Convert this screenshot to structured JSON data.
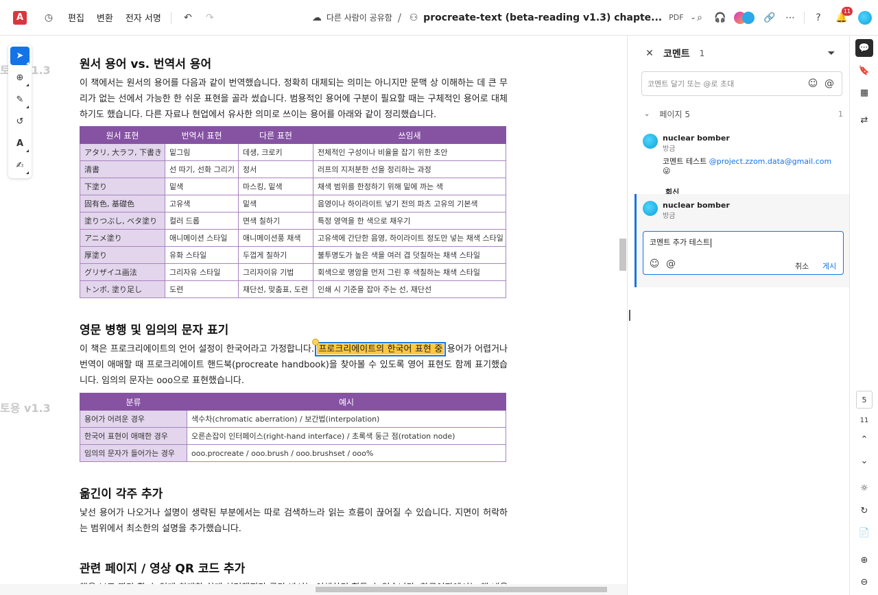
{
  "topbar": {
    "logo": "A",
    "menu": [
      "편집",
      "변환",
      "전자 서명"
    ],
    "share": "다른 사람이 공유함",
    "title": "procreate-text (beta-reading v1.3) chapte...",
    "filetype": "PDF",
    "notification_count": "11"
  },
  "ghost_labels": [
    "토용 v1.3",
    "토용 v1.3"
  ],
  "document": {
    "section1": {
      "heading": "원서 용어 vs. 번역서 용어",
      "body": "이 책에서는 원서의 용어를 다음과 같이 번역했습니다. 정확히 대체되는 의미는 아니지만 문맥 상 이해하는 데 큰 무리가 없는 선에서 가능한 한 쉬운 표현을 골라 썼습니다. 범용적인 용어에 구분이 필요할 때는 구체적인 용어로 대체하기도 했습니다. 다른 자료나 현업에서 유사한 의미로 쓰이는 용어를 아래와 같이 정리했습니다.",
      "table": {
        "headers": [
          "원서 표현",
          "번역서 표현",
          "다른 표현",
          "쓰임새"
        ],
        "rows": [
          [
            "アタリ, 大ラフ, 下書き",
            "밑그림",
            "데생, 크로키",
            "전체적인 구성이나 비율을 잡기 위한 초안"
          ],
          [
            "清書",
            "선 따기, 선화 그리기",
            "정서",
            "러프의 지저분한 선을 정리하는 과정"
          ],
          [
            "下塗り",
            "밑색",
            "마스킹, 밑색",
            "채색 범위를 한정하기 위해 밑에 까는 색"
          ],
          [
            "固有色, 基礎色",
            "고유색",
            "밑색",
            "음영이나 하이라이트 넣기 전의 파츠 고유의 기본색"
          ],
          [
            "塗りつぶし, ベタ塗り",
            "컬러 드롭",
            "면색 칠하기",
            "특정 영역을 한 색으로 채우기"
          ],
          [
            "アニメ塗り",
            "애니메이션 스타일",
            "애니메이션풍 채색",
            "고유색에 간단한 음영, 하이라이트 정도만 넣는 채색 스타일"
          ],
          [
            "厚塗り",
            "유화 스타일",
            "두껍게 칠하기",
            "불투명도가 높은 색을 여러 겹 덧칠하는 채색 스타일"
          ],
          [
            "グリザイユ画法",
            "그리자유 스타일",
            "그리자이유 기법",
            "회색으로 명암을 먼저 그린 후 색칠하는 채색 스타일"
          ],
          [
            "トンボ, 塗り足し",
            "도련",
            "재단선, 맞춤표, 도련",
            "인쇄 시 기준을 잡아 주는 선, 재단선"
          ]
        ]
      }
    },
    "section2": {
      "heading": "영문 병행 및 임의의 문자 표기",
      "body_before": "이 책은 프로크리에이트의 언어 설정이 한국어라고 가정합니다.",
      "highlight": "프로크리에이트의 한국어 표현 중",
      "body_after": "용어가 어렵거나 번역이 애매할 때 프로크리에이트 핸드북(procreate handbook)을 찾아볼 수 있도록 영어 표현도 함께 표기했습니다. 임의의 문자는 ooo으로 표현했습니다.",
      "table": {
        "headers": [
          "분류",
          "예시"
        ],
        "rows": [
          [
            "용어가 어려운 경우",
            "색수차(chromatic aberration) / 보간법(interpolation)"
          ],
          [
            "한국어 표현이 애매한 경우",
            "오른손잡이 인터페이스(right-hand interface) / 초록색 둥근 점(rotation node)"
          ],
          [
            "임의의 문자가 들어가는 경우",
            "ooo.procreate / ooo.brush / ooo.brushset / ooo%"
          ]
        ]
      }
    },
    "section3": {
      "heading": "옮긴이 각주 추가",
      "body": "낯선 용어가 나오거나 설명이 생략된 부분에서는 따로 검색하느라 읽는 흐름이 끊어질 수 있습니다. 지면이 허락하는 범위에서 최소한의 설명을 추가했습니다."
    },
    "section4": {
      "heading": "관련 페이지 / 영상 QR 코드 추가",
      "body": "책을 보고 따라 할 수 있게 최대한 쉽게 설명했지만 글만 봐서는 이해하기 힘들 수 있습니다. 한국어판에서는 책 내용"
    }
  },
  "comments": {
    "title": "코멘트",
    "count": "1",
    "input_placeholder": "코멘트 달기 또는 @로 초대",
    "page_label": "페이지 5",
    "page_count": "1",
    "thread": {
      "author": "nuclear bomber",
      "time": "방금",
      "text": "코멘트 테스트",
      "mention": "@project.zzom.data@gmail.com",
      "emoji": "😜",
      "reply_label": "회신"
    },
    "reply": {
      "author": "nuclear bomber",
      "time": "방금",
      "draft": "코멘트 추가 테스트",
      "cancel": "취소",
      "post": "게시"
    }
  },
  "rail": {
    "current_page": "5",
    "total_pages": "11"
  }
}
